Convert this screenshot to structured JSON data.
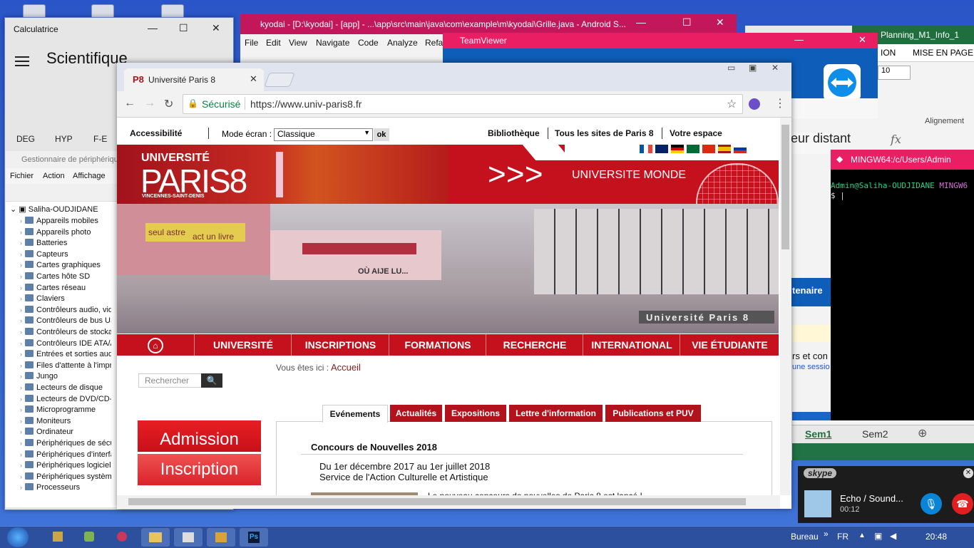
{
  "calculator": {
    "title": "Calculatrice",
    "mode": "Scientifique",
    "functions": [
      "DEG",
      "HYP",
      "F-E"
    ]
  },
  "device_manager": {
    "title": "Gestionnaire de périphériques",
    "menu": [
      "Fichier",
      "Action",
      "Affichage"
    ],
    "root": "Saliha-OUDJIDANE",
    "items": [
      "Appareils mobiles",
      "Appareils photo",
      "Batteries",
      "Capteurs",
      "Cartes graphiques",
      "Cartes hôte SD",
      "Cartes réseau",
      "Claviers",
      "Contrôleurs audio, vid",
      "Contrôleurs de bus US",
      "Contrôleurs de stockag",
      "Contrôleurs IDE ATA/A",
      "Entrées et sorties audi",
      "Files d'attente à l'impr",
      "Jungo",
      "Lecteurs de disque",
      "Lecteurs de DVD/CD-R",
      "Microprogramme",
      "Moniteurs",
      "Ordinateur",
      "Périphériques de sécu",
      "Périphériques d'interfa",
      "Périphériques logiciels",
      "Périphériques système",
      "Processeurs"
    ]
  },
  "android_studio": {
    "title": "kyodai - [D:\\kyodai] - [app] - ...\\app\\src\\main\\java\\com\\example\\m\\kyodai\\Grille.java - Android S...",
    "menu": [
      "File",
      "Edit",
      "View",
      "Navigate",
      "Code",
      "Analyze",
      "Refa"
    ]
  },
  "teamviewer": {
    "title": "TeamViewer",
    "partial_text": "teur distant",
    "partial_text2": "tenaire"
  },
  "excel": {
    "title": "Planning_M1_Info_1",
    "ribbon": [
      "ION",
      "MISE EN PAGE"
    ],
    "font_size": "10",
    "group_label": "Alignement",
    "formula_label": "fx",
    "sheet_tabs": [
      "Sem1",
      "Sem2"
    ],
    "snippet1": "rs et con",
    "snippet2": "une sessio"
  },
  "mingw": {
    "title": "MINGW64:/c/Users/Admin",
    "prompt_user": "Admin@Saliha-OUDJIDANE",
    "prompt_env": "MINGW6",
    "prompt_sym": "$"
  },
  "skype": {
    "label": "skype",
    "call_name": "Echo / Sound...",
    "call_time": "00:12"
  },
  "browser": {
    "tab_title": "Université Paris 8",
    "secure_label": "Sécurisé",
    "url": "https://www.univ-paris8.fr"
  },
  "site": {
    "accessibility": "Accessibilité",
    "mode_label": "Mode écran :",
    "mode_value": "Classique",
    "ok": "ok",
    "top_links": [
      "Bibliothèque",
      "Tous les sites de Paris 8",
      "Votre espace"
    ],
    "logo_line1": "UNIVERSITÉ",
    "logo_line2": "PARIS8",
    "logo_line3": "VINCENNES-SAINT-DENIS",
    "monde": "UNIVERSITE MONDE",
    "banner_text1": "seul astre",
    "banner_text2": "act un livre",
    "banner_text3": "OÙ AIJE LU...",
    "banner_text4": "Université Paris 8",
    "nav": [
      "UNIVERSITÉ",
      "INSCRIPTIONS",
      "FORMATIONS",
      "RECHERCHE",
      "INTERNATIONAL",
      "VIE ÉTUDIANTE"
    ],
    "search_placeholder": "Rechercher",
    "breadcrumb_label": "Vous êtes ici :",
    "breadcrumb_current": "Accueil",
    "tabs": [
      "Evénements",
      "Actualités",
      "Expositions",
      "Lettre d'information",
      "Publications et PUV"
    ],
    "news_title": "Concours de Nouvelles 2018",
    "news_date": "Du 1er décembre 2017 au 1er juillet 2018",
    "news_org": "Service de l'Action Culturelle et Artistique",
    "news_teaser": "Le nouveau concours de nouvelles de Paris 8 est lancé !",
    "admission": "Admission",
    "inscription": "Inscription"
  },
  "taskbar": {
    "bureau": "Bureau",
    "lang": "FR",
    "time": "20:48",
    "ps_label": "Ps"
  },
  "colors": {
    "p8_red": "#c4111d",
    "titlebar_pink": "#e91e63",
    "teamviewer_blue": "#0e5db8"
  }
}
